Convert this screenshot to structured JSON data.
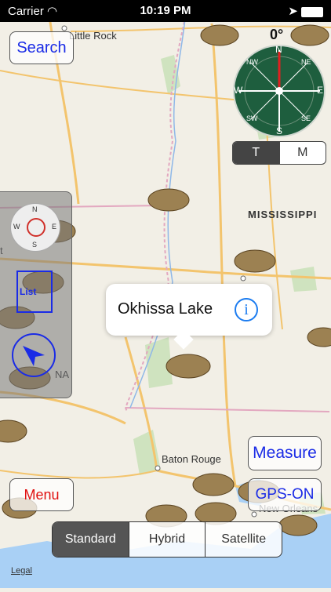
{
  "status_bar": {
    "carrier": "Carrier",
    "time": "10:19 PM"
  },
  "map_labels": {
    "little_rock": "Little Rock",
    "mississippi": "MISSISSIPPI",
    "baton_rouge": "Baton Rouge",
    "new_orleans": "New Orleans",
    "partial_t": "t",
    "partial_na": "NA"
  },
  "buttons": {
    "search": "Search",
    "menu": "Menu",
    "measure": "Measure",
    "gps": "GPS-ON"
  },
  "compass": {
    "heading": "0°",
    "north": "N",
    "south": "S",
    "east": "E",
    "west": "W",
    "nw": "NW",
    "ne": "NE",
    "sw": "SW",
    "se": "SE"
  },
  "tm_toggle": {
    "t": "T",
    "m": "M",
    "selected": "T"
  },
  "side_panel": {
    "small_compass_n": "N",
    "small_compass_s": "S",
    "small_compass_e": "E",
    "small_compass_w": "W",
    "list": "List"
  },
  "callout": {
    "title": "Okhissa Lake"
  },
  "map_type": {
    "options": [
      "Standard",
      "Hybrid",
      "Satellite"
    ],
    "selected": "Standard"
  },
  "legal": "Legal",
  "colors": {
    "accent_blue": "#1a2be6",
    "menu_red": "#e01010",
    "compass_green": "#1e5e3e"
  }
}
